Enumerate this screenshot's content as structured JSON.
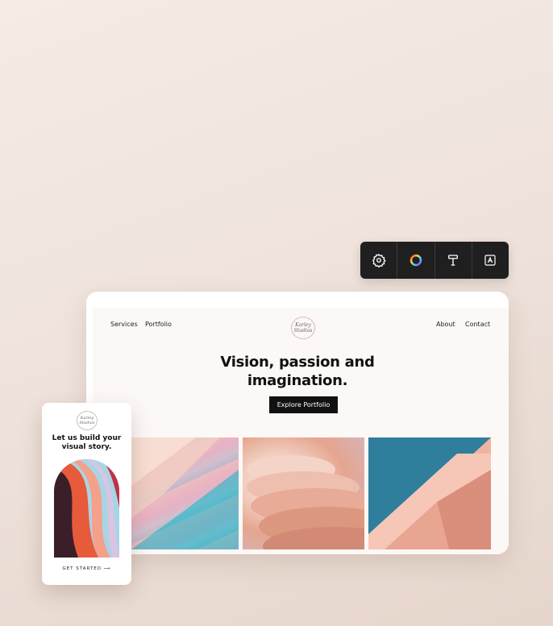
{
  "toolbar": {
    "tools": [
      {
        "name": "gear-icon"
      },
      {
        "name": "color-wheel-icon"
      },
      {
        "name": "text-style-icon"
      },
      {
        "name": "font-icon"
      }
    ]
  },
  "desktop": {
    "nav_left": [
      "Services",
      "Portfolio"
    ],
    "nav_right": [
      "About",
      "Contact"
    ],
    "logo_text": "Karley Studios",
    "hero_title_line1": "Vision, passion and",
    "hero_title_line2": "imagination.",
    "cta_label": "Explore Portfolio"
  },
  "phone": {
    "logo_text": "Karley Studios",
    "title_line1": "Let us build your",
    "title_line2": "visual story.",
    "cta_label": "GET STARTED ⟶"
  },
  "colors": {
    "accent_dark": "#111111",
    "toolbar_bg": "#1f1f1f"
  }
}
